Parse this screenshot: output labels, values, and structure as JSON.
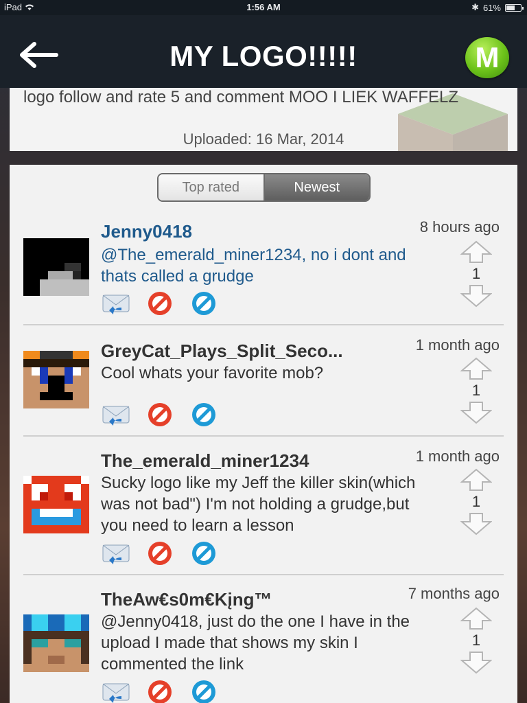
{
  "status_bar": {
    "device": "iPad",
    "time": "1:56 AM",
    "battery_text": "61%",
    "battery_level": 0.61
  },
  "header": {
    "title": "MY LOGO!!!!!",
    "logo_letter": "M"
  },
  "description": {
    "text": "logo follow and rate 5 and comment MOO I LIEK WAFFELZ",
    "uploaded": "Uploaded: 16 Mar, 2014"
  },
  "tabs": [
    {
      "label": "Top rated",
      "active": false
    },
    {
      "label": "Newest",
      "active": true
    }
  ],
  "comments": [
    {
      "user": "Jenny0418",
      "time": "8 hours ago",
      "text": "@The_emerald_miner1234, no i dont and thats called a grudge",
      "score": "1",
      "highlight": true
    },
    {
      "user": "GreyCat_Plays_Split_Seco...",
      "time": "1 month ago",
      "text": "Cool whats your favorite mob?",
      "score": "1",
      "highlight": false
    },
    {
      "user": "The_emerald_miner1234",
      "time": "1 month ago",
      "text": "Sucky logo like my Jeff the killer skin(which was not bad\") I'm not holding a grudge,but you need to learn a lesson",
      "score": "1",
      "highlight": false
    },
    {
      "user": "TheAw€s0m€Kįng™",
      "time": "7 months ago",
      "text": "@Jenny0418, just do the one I have in the upload I made that shows my skin I commented the link",
      "score": "1",
      "highlight": false
    }
  ],
  "colors": {
    "accent_blue": "#1f5a8c",
    "logo_green": "#6cc21a",
    "reply_blue": "#2a78c8",
    "report_red": "#e5402a",
    "block_blue": "#1e9ad6"
  },
  "icons": [
    "back-arrow-icon",
    "reply-icon",
    "report-icon",
    "block-icon",
    "vote-up-icon",
    "vote-down-icon"
  ]
}
